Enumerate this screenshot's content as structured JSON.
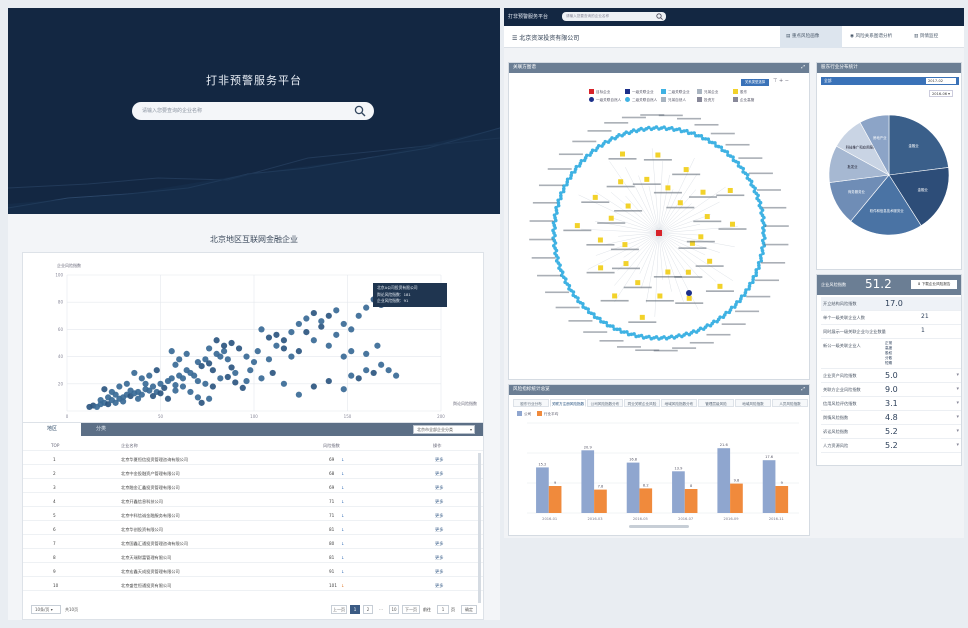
{
  "left": {
    "hero_title": "打非预警服务平台",
    "search_placeholder": "请输入您要查询的企业名称",
    "section_title": "北京地区互联网金融企业",
    "scatter": {
      "ylabel": "企业风险指数",
      "xlabel": "舆论风险指数",
      "yticks": [
        "100",
        "80",
        "60",
        "40",
        "20"
      ],
      "xticks": [
        "0",
        "50",
        "100",
        "150",
        "200"
      ],
      "tooltip": [
        "北京A公司投资有限公司",
        "舆论风险指数：181",
        "企业风险指数：91"
      ]
    },
    "table": {
      "tabs": [
        "地区",
        "分类"
      ],
      "select": "北京市全部企业分类",
      "headers": [
        "TOP",
        "企业名称",
        "风险指数",
        "操作"
      ],
      "rows": [
        {
          "rank": "1",
          "name": "北京华夏恒信投资管理咨询有限公司",
          "score": "69",
          "action": "更多"
        },
        {
          "rank": "2",
          "name": "北京中金投融资产管理有限公司",
          "score": "68",
          "action": "更多"
        },
        {
          "rank": "3",
          "name": "北京融金汇鑫投资管理有限公司",
          "score": "69",
          "action": "更多"
        },
        {
          "rank": "4",
          "name": "北京开鑫信息科技公司",
          "score": "71",
          "action": "更多"
        },
        {
          "rank": "5",
          "name": "北京中科信诚金融服务有限公司",
          "score": "71",
          "action": "更多"
        },
        {
          "rank": "6",
          "name": "北京华创投资有限公司",
          "score": "81",
          "action": "更多"
        },
        {
          "rank": "7",
          "name": "北京国鑫汇通投资管理咨询有限公司",
          "score": "80",
          "action": "更多"
        },
        {
          "rank": "8",
          "name": "北京天瑞财富管理有限公司",
          "score": "81",
          "action": "更多"
        },
        {
          "rank": "9",
          "name": "北京宏鑫天成投资管理有限公司",
          "score": "91",
          "action": "更多"
        },
        {
          "rank": "10",
          "name": "北京盛世恒通投资有限公司",
          "score": "101",
          "action": "更多"
        }
      ],
      "page_size": "10条/页",
      "total": "共10页",
      "pager": [
        "上一页",
        "1",
        "2",
        "...",
        "10",
        "下一页",
        "前往",
        "1",
        "页",
        "确定"
      ]
    }
  },
  "right": {
    "topbar_title": "打非预警服务平台",
    "topbar_search": "请输入您要查询的企业名称",
    "company": "北京资深投资有限公司",
    "tabs": [
      "重点风险画像",
      "风险关系图谱分析",
      "舆情监控"
    ],
    "graph": {
      "title": "关联方图谱",
      "btn": "关系类型选择",
      "legend": [
        "目标企业",
        "一级关联企业",
        "二级关联企业",
        "兄弟企业",
        "股东",
        "一级关联自然人",
        "二级关联自然人",
        "兄弟自然人",
        "投资方",
        "企业高管"
      ]
    },
    "bar": {
      "title": "风险指标统计总览",
      "subtabs": [
        "股东行业分布",
        "关联方注册风险指数",
        "公司风险指数分布",
        "同业关联企业风险",
        "地域风险指数分布",
        "管理层级风险",
        "地域风险指数",
        "人员风险指数"
      ],
      "legend": [
        "公司",
        "行业平均"
      ]
    },
    "pie": {
      "title": "股东行业分布统计",
      "select_left": "全部",
      "select_right": "2017-02",
      "year": "2016-06"
    },
    "scores": {
      "title": "企业风险指数",
      "value": "51.2",
      "button": "下载企业风险报告",
      "rows": [
        {
          "label": "开立结构风险指数",
          "value": "17.0"
        },
        {
          "label": "单个一级关联企业人数",
          "value": "21"
        },
        {
          "label": "同时展示一级关联企业与企业数量",
          "value": "1"
        },
        {
          "label": "新公一级关联企业人",
          "value": "正常\n高度\n股权\n分散\n短期"
        },
        {
          "label": "企业资产风险指数",
          "value": "5.0"
        },
        {
          "label": "关联方企业风险指数",
          "value": "9.0"
        },
        {
          "label": "信用风险评估指数",
          "value": "3.1"
        },
        {
          "label": "舆情风险指数",
          "value": "4.8"
        },
        {
          "label": "诉讼风险指数",
          "value": "5.2"
        },
        {
          "label": "人力资源风险",
          "value": "5.2"
        }
      ]
    }
  },
  "chart_data": [
    {
      "type": "scatter",
      "title": "",
      "xlabel": "舆论风险指数",
      "ylabel": "企业风险指数",
      "xlim": [
        0,
        200
      ],
      "ylim": [
        0,
        100
      ],
      "grid": true,
      "series": [
        {
          "points": [
            [
              12,
              3
            ],
            [
              14,
              4
            ],
            [
              16,
              3
            ],
            [
              18,
              5
            ],
            [
              20,
              6
            ],
            [
              22,
              5
            ],
            [
              24,
              8
            ],
            [
              26,
              6
            ],
            [
              28,
              9
            ],
            [
              30,
              10
            ],
            [
              32,
              12
            ],
            [
              34,
              11
            ],
            [
              36,
              13
            ],
            [
              38,
              14
            ],
            [
              40,
              12
            ],
            [
              42,
              16
            ],
            [
              44,
              15
            ],
            [
              46,
              18
            ],
            [
              48,
              14
            ],
            [
              50,
              20
            ],
            [
              52,
              17
            ],
            [
              54,
              22
            ],
            [
              56,
              24
            ],
            [
              58,
              19
            ],
            [
              60,
              26
            ],
            [
              62,
              24
            ],
            [
              64,
              30
            ],
            [
              66,
              28
            ],
            [
              68,
              26
            ],
            [
              70,
              36
            ],
            [
              72,
              33
            ],
            [
              74,
              38
            ],
            [
              76,
              35
            ],
            [
              78,
              30
            ],
            [
              80,
              42
            ],
            [
              82,
              40
            ],
            [
              84,
              44
            ],
            [
              86,
              38
            ],
            [
              88,
              32
            ],
            [
              90,
              28
            ],
            [
              18,
              8
            ],
            [
              22,
              10
            ],
            [
              26,
              12
            ],
            [
              30,
              7
            ],
            [
              34,
              15
            ],
            [
              38,
              9
            ],
            [
              42,
              20
            ],
            [
              46,
              11
            ],
            [
              50,
              13
            ],
            [
              54,
              9
            ],
            [
              58,
              15
            ],
            [
              62,
              18
            ],
            [
              66,
              14
            ],
            [
              70,
              22
            ],
            [
              74,
              20
            ],
            [
              78,
              18
            ],
            [
              82,
              24
            ],
            [
              86,
              25
            ],
            [
              90,
              21
            ],
            [
              94,
              17
            ],
            [
              70,
              10
            ],
            [
              72,
              6
            ],
            [
              76,
              9
            ],
            [
              96,
              22
            ],
            [
              100,
              36
            ],
            [
              104,
              24
            ],
            [
              108,
              38
            ],
            [
              112,
              48
            ],
            [
              116,
              52
            ],
            [
              120,
              40
            ],
            [
              124,
              44
            ],
            [
              128,
              58
            ],
            [
              132,
              52
            ],
            [
              136,
              62
            ],
            [
              140,
              48
            ],
            [
              144,
              56
            ],
            [
              148,
              40
            ],
            [
              152,
              44
            ],
            [
              104,
              60
            ],
            [
              108,
              54
            ],
            [
              112,
              56
            ],
            [
              116,
              46
            ],
            [
              120,
              58
            ],
            [
              124,
              64
            ],
            [
              128,
              68
            ],
            [
              132,
              72
            ],
            [
              136,
              66
            ],
            [
              140,
              70
            ],
            [
              144,
              74
            ],
            [
              148,
              64
            ],
            [
              152,
              60
            ],
            [
              156,
              70
            ],
            [
              160,
              76
            ],
            [
              164,
              82
            ],
            [
              168,
              78
            ],
            [
              172,
              88
            ],
            [
              176,
              84
            ],
            [
              180,
              90
            ],
            [
              148,
              16
            ],
            [
              152,
              26
            ],
            [
              156,
              24
            ],
            [
              160,
              30
            ],
            [
              164,
              28
            ],
            [
              168,
              34
            ],
            [
              172,
              30
            ],
            [
              176,
              26
            ],
            [
              160,
              42
            ],
            [
              166,
              48
            ],
            [
              140,
              22
            ],
            [
              132,
              18
            ],
            [
              124,
              12
            ],
            [
              116,
              20
            ],
            [
              110,
              28
            ],
            [
              98,
              30
            ],
            [
              102,
              44
            ],
            [
              92,
              46
            ],
            [
              96,
              40
            ],
            [
              88,
              50
            ],
            [
              84,
              48
            ],
            [
              80,
              52
            ],
            [
              76,
              46
            ],
            [
              60,
              38
            ],
            [
              64,
              42
            ],
            [
              56,
              44
            ],
            [
              58,
              34
            ],
            [
              48,
              30
            ],
            [
              44,
              26
            ],
            [
              40,
              24
            ],
            [
              36,
              28
            ],
            [
              32,
              20
            ],
            [
              28,
              18
            ],
            [
              24,
              14
            ],
            [
              20,
              16
            ]
          ],
          "highlight": [
            181,
            91
          ]
        }
      ]
    },
    {
      "type": "bar",
      "title": "",
      "categories": [
        "2016-01",
        "2016-03",
        "2016-05",
        "2016-07",
        "2016-09",
        "2016-11"
      ],
      "ylim": [
        0,
        30
      ],
      "series": [
        {
          "name": "公司",
          "color": "#8fa6cf",
          "values": [
            15.2,
            20.9,
            16.8,
            13.9,
            21.6,
            17.6
          ]
        },
        {
          "name": "行业平均",
          "color": "#f08a3c",
          "values": [
            9.0,
            7.8,
            8.2,
            8.0,
            9.8,
            9.0
          ]
        }
      ]
    },
    {
      "type": "pie",
      "title": "",
      "slices": [
        {
          "label": "金融业",
          "value": 23,
          "color": "#3a5f8a"
        },
        {
          "label": "金融业",
          "value": 18,
          "color": "#2d4d78"
        },
        {
          "label": "软件和信息技术服务业",
          "value": 20,
          "color": "#4a73a4"
        },
        {
          "label": "商务服务业",
          "value": 12,
          "color": "#6f8db6"
        },
        {
          "label": "批发业",
          "value": 10,
          "color": "#a6b8d2"
        },
        {
          "label": "科技推广和应用服务业",
          "value": 9,
          "color": "#c9d4e4"
        },
        {
          "label": "房地产业",
          "value": 8,
          "color": "#8ca4c7"
        }
      ]
    }
  ]
}
